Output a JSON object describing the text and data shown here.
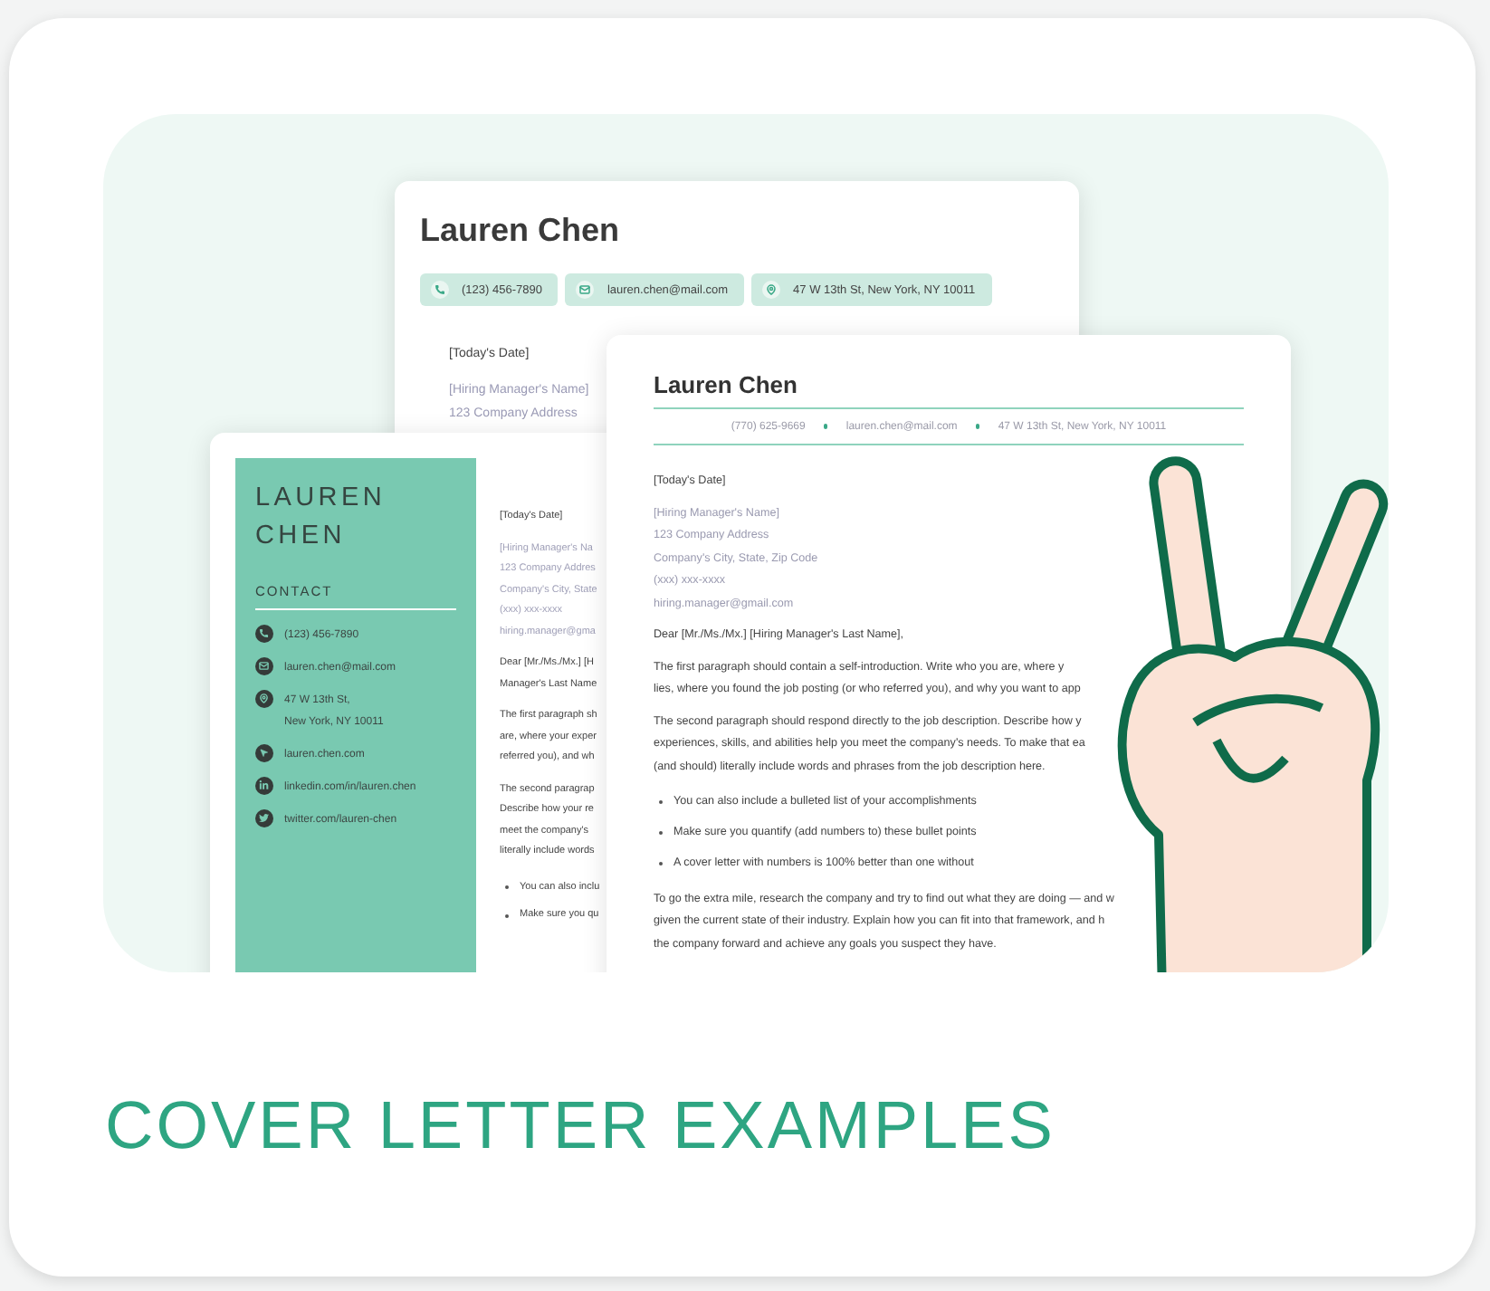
{
  "card": {
    "title": "COVER LETTER EXAMPLES"
  },
  "documents": [
    {
      "kind": "chips",
      "name": "Lauren Chen",
      "contacts": [
        {
          "kind": "phone",
          "lines": [
            "(123) 456-7890"
          ]
        },
        {
          "kind": "mail",
          "lines": [
            "lauren.chen@mail.com"
          ]
        },
        {
          "kind": "pin",
          "lines": [
            "47 W 13th St, New York, NY 10011"
          ]
        }
      ],
      "blocks": [
        {
          "kind": "date",
          "lines": [
            "[Today's Date]"
          ]
        },
        {
          "kind": "recipient",
          "lines": [
            "[Hiring Manager's Name]",
            "123 Company Address"
          ]
        }
      ]
    },
    {
      "kind": "sidebar",
      "name_lines": [
        "LAUREN",
        "CHEN"
      ],
      "section": "CONTACT",
      "contacts": [
        {
          "kind": "phone",
          "lines": [
            "(123) 456-7890"
          ]
        },
        {
          "kind": "mail",
          "lines": [
            "lauren.chen@mail.com"
          ]
        },
        {
          "kind": "pin",
          "lines": [
            "47 W 13th St,",
            "New York, NY 10011"
          ]
        },
        {
          "kind": "web",
          "lines": [
            "lauren.chen.com"
          ]
        },
        {
          "kind": "linkedin",
          "lines": [
            "linkedin.com/in/lauren.chen"
          ]
        },
        {
          "kind": "twitter",
          "lines": [
            "twitter.com/lauren-chen"
          ]
        }
      ],
      "blocks": [
        {
          "kind": "date",
          "lines": [
            "[Today's Date]"
          ]
        },
        {
          "kind": "recipient",
          "lines": [
            "[Hiring Manager's Na",
            "123 Company Addres",
            "Company's City, State",
            "(xxx) xxx-xxxx",
            "hiring.manager@gma"
          ]
        },
        {
          "kind": "paragraph",
          "lines": [
            "Dear [Mr./Ms./Mx.] [H",
            "Manager's Last Name"
          ]
        },
        {
          "kind": "paragraph",
          "lines": [
            "The first paragraph sh",
            "are, where your exper",
            "referred you), and wh"
          ]
        },
        {
          "kind": "paragraph",
          "lines": [
            "The second paragrap",
            "Describe how your re",
            "meet the company's",
            "literally include words"
          ]
        },
        {
          "kind": "bullets",
          "lines": [
            "You can also inclu",
            "Make sure you qu"
          ]
        }
      ]
    },
    {
      "kind": "centered",
      "name": "Lauren Chen",
      "contacts": [
        {
          "lines": [
            "(770) 625-9669"
          ]
        },
        {
          "lines": [
            "lauren.chen@mail.com"
          ]
        },
        {
          "lines": [
            "47 W 13th St, New York, NY 10011"
          ]
        }
      ],
      "blocks": [
        {
          "kind": "date",
          "lines": [
            "[Today's Date]"
          ]
        },
        {
          "kind": "recipient",
          "lines": [
            "[Hiring Manager's Name]",
            "123 Company Address",
            "Company's City, State, Zip Code",
            "(xxx) xxx-xxxx",
            "hiring.manager@gmail.com"
          ]
        },
        {
          "kind": "paragraph",
          "lines": [
            "Dear [Mr./Ms./Mx.] [Hiring Manager's Last Name],"
          ]
        },
        {
          "kind": "paragraph",
          "lines": [
            "The first paragraph should contain a self-introduction. Write who you are, where y",
            "lies, where you found the job posting (or who referred you), and why you want to app"
          ]
        },
        {
          "kind": "paragraph",
          "lines": [
            "The second paragraph should respond directly to the job description. Describe how y",
            "experiences, skills, and abilities help you meet the company's needs. To make that ea",
            "(and should) literally include words and phrases from the job description here."
          ]
        },
        {
          "kind": "bullets",
          "lines": [
            "You can also include a bulleted list of your accomplishments",
            "Make sure you quantify (add numbers to) these bullet points",
            "A cover letter with numbers is 100% better than one without"
          ]
        },
        {
          "kind": "paragraph",
          "lines": [
            "To go the extra mile, research the company and try to find out what they are doing — and w",
            "given the current state of their industry. Explain how you can fit into that framework, and h",
            "the company forward and achieve any goals you suspect they have."
          ]
        }
      ]
    }
  ]
}
